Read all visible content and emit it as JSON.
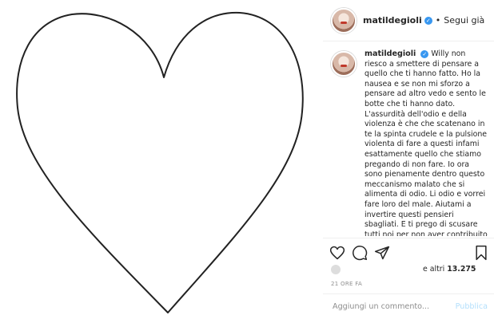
{
  "post": {
    "media": {
      "description_icon": "heart-outline"
    },
    "header": {
      "username": "matildegioli",
      "separator": "•",
      "follow_label": "Segui già"
    },
    "caption": {
      "username": "matildegioli",
      "text": "Willy non riesco a smettere di pensare a quello che ti hanno fatto. Ho la nausea e se non mi sforzo a pensare ad altro vedo e sento le botte che ti hanno dato. L'assurdità dell'odio e della violenza è che che scatenano in te la spinta crudele e la pulsione violenta di fare a questi infami esattamente quello che stiamo pregando di non fare. Io ora sono pienamente dentro questo meccanismo malato che si alimenta di odio. Li odio e vorrei fare loro del male. Aiutami a invertire questi pensieri sbagliati. E ti prego di scusare tutti noi per non aver contribuito abbastanza affinché elementi come questi non potessero circolare. Ti abbraccio Willy♥"
    },
    "actions": {
      "like_icon": "heart-icon",
      "comment_icon": "comment-icon",
      "share_icon": "share-icon",
      "save_icon": "bookmark-icon"
    },
    "likes": {
      "prefix": "e altri",
      "count": "13.275"
    },
    "timestamp": "21 ORE FA",
    "add_comment": {
      "placeholder": "Aggiungi un commento...",
      "publish_label": "Pubblica"
    },
    "colors": {
      "verified": "#3897f0",
      "publish_disabled": "#b2dffc",
      "border": "#efefef",
      "muted": "#8e8e8e"
    }
  }
}
